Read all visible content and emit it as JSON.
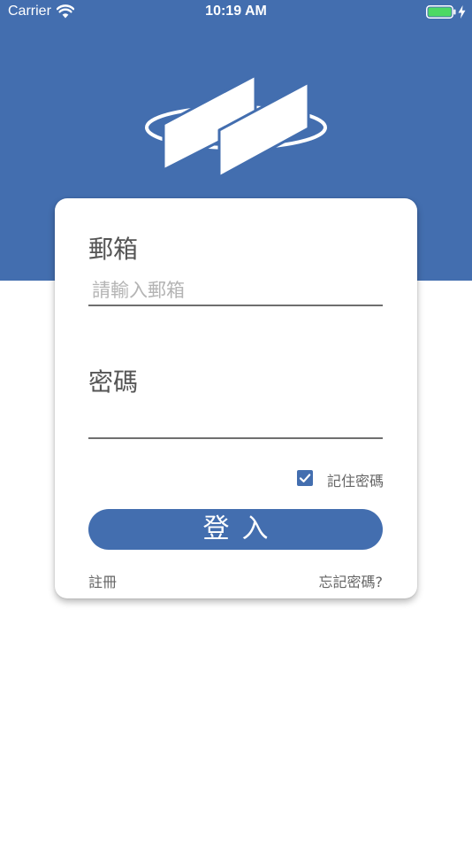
{
  "status_bar": {
    "carrier": "Carrier",
    "time": "10:19 AM",
    "wifi_icon": "wifi-icon",
    "battery_icon": "battery-icon",
    "charge_icon": "charging-bolt-icon"
  },
  "colors": {
    "brand": "#436eaf",
    "battery": "#4cd964"
  },
  "logo": {
    "icon": "parallel-panels-ring-logo"
  },
  "login_form": {
    "email_label": "郵箱",
    "email_placeholder": "請輸入郵箱",
    "email_value": "",
    "password_label": "密碼",
    "password_value": "",
    "remember_label": "記住密碼",
    "remember_checked": true,
    "login_button": "登入",
    "register_link": "註冊",
    "forgot_link": "忘記密碼?"
  }
}
